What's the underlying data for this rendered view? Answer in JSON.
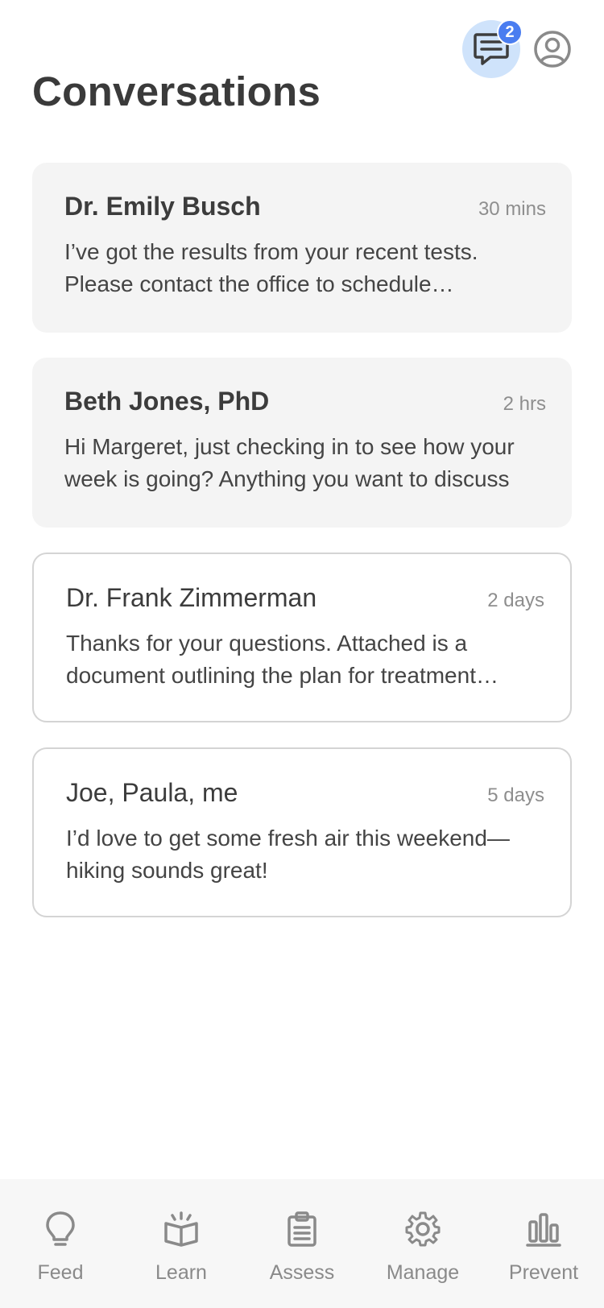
{
  "header": {
    "title": "Conversations",
    "messages_badge": "2",
    "messages_icon": "chat-icon",
    "profile_icon": "profile-icon",
    "accent_color": "#4a7df0"
  },
  "conversations": [
    {
      "sender": "Dr. Emily Busch",
      "time": "30 mins",
      "preview": "I’ve got the results from your recent tests. Please contact the office to schedule…",
      "unread": true
    },
    {
      "sender": "Beth Jones, PhD",
      "time": "2 hrs",
      "preview": "Hi Margeret, just checking in to see how your week is going? Anything you want to discuss",
      "unread": true
    },
    {
      "sender": "Dr. Frank Zimmerman",
      "time": "2 days",
      "preview": "Thanks for your questions. Attached is a document outlining the plan for treatment…",
      "unread": false
    },
    {
      "sender": "Joe, Paula, me",
      "time": "5 days",
      "preview": "I’d love to get some fresh air this weekend—hiking sounds great!",
      "unread": false
    }
  ],
  "nav": [
    {
      "label": "Feed",
      "icon": "lightbulb-icon"
    },
    {
      "label": "Learn",
      "icon": "book-icon"
    },
    {
      "label": "Assess",
      "icon": "clipboard-icon"
    },
    {
      "label": "Manage",
      "icon": "gear-icon"
    },
    {
      "label": "Prevent",
      "icon": "bar-chart-icon"
    }
  ]
}
